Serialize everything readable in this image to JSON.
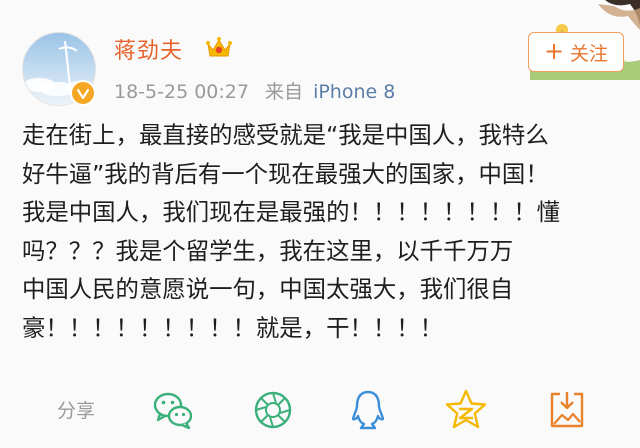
{
  "post": {
    "username": "蒋劲夫",
    "timestamp": "18-5-25 00:27",
    "source_prefix": "来自",
    "device": "iPhone 8",
    "text": "走在街上，最直接的感受就是“我是中国人，我特么\n好牛逼”我的背后有一个现在最强大的国家，中国！\n我是中国人，我们现在是最强的！！！！！！！！懂\n吗？？？我是个留学生，我在这里，以千千万万\n中国人民的意愿说一句，中国太强大，我们很自\n豪！！！！！！！！！就是，干！！！！"
  },
  "follow_button": {
    "label": "关注"
  },
  "share": {
    "label": "分享",
    "icons": [
      "wechat-icon",
      "moments-icon",
      "qq-icon",
      "qzone-icon",
      "save-image-icon"
    ]
  },
  "colors": {
    "username": "#e8632b",
    "accent": "#f0a060",
    "share_icon_green": "#3bb07a",
    "share_icon_blue": "#3b8fd8",
    "share_icon_yellow": "#f5b800",
    "share_icon_orange": "#e8832b",
    "meta_gray": "#9a9a9a"
  }
}
